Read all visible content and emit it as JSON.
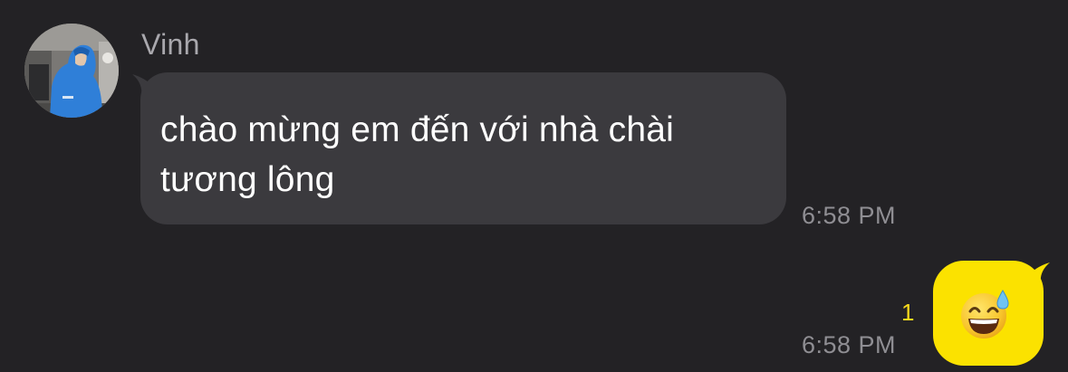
{
  "conversation": {
    "incoming": {
      "sender_name": "Vinh",
      "avatar_icon": "profile-photo-person-blue-hoodie",
      "text": "chào mừng em đến với nhà chài tương lông",
      "time": "6:58 PM",
      "bubble_color": "#3b3a3e"
    },
    "outgoing": {
      "unread_count": "1",
      "time": "6:58 PM",
      "emoji_icon": "grinning-face-with-sweat-emoji",
      "bubble_color": "#fbe200"
    }
  },
  "colors": {
    "background": "#232225",
    "accent_yellow": "#fbe200",
    "unread_yellow": "#f7d91c",
    "meta_gray": "#8f8e93"
  }
}
